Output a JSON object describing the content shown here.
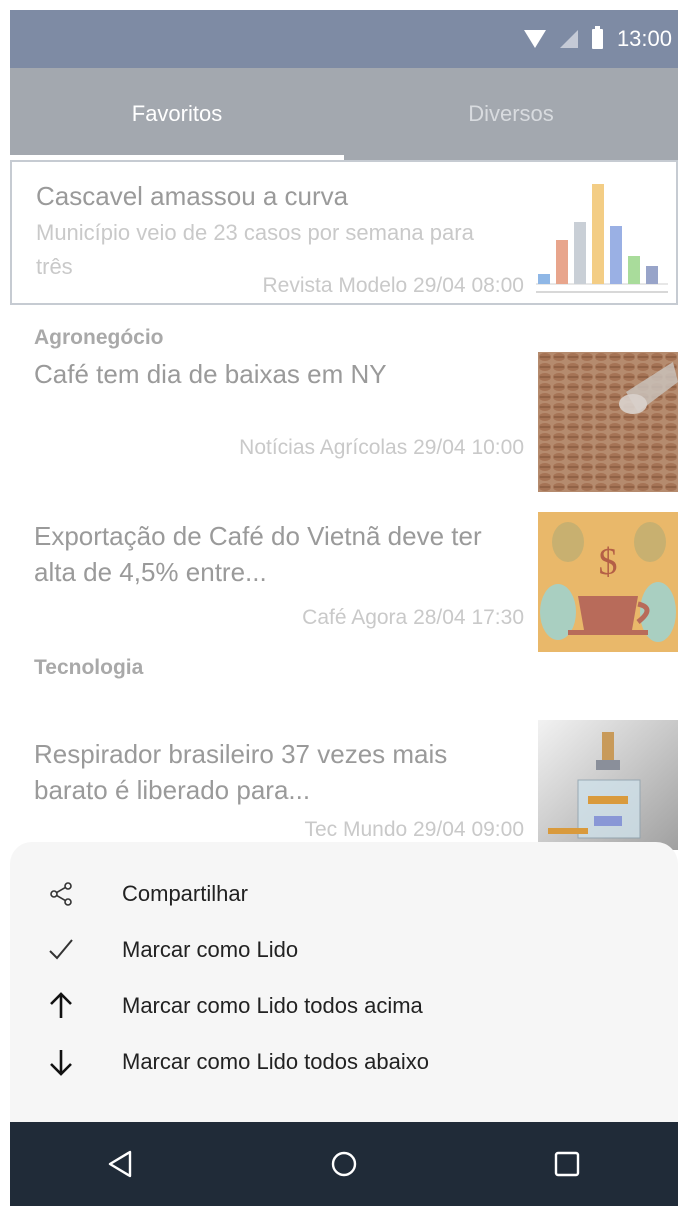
{
  "status_bar": {
    "time": "13:00",
    "icons": [
      "wifi-icon",
      "signal-icon",
      "battery-icon"
    ]
  },
  "tabs": [
    {
      "label": "Favoritos",
      "active": true
    },
    {
      "label": "Diversos",
      "active": false
    }
  ],
  "news": {
    "highlight": {
      "title": "Cascavel amassou a curva",
      "description": "Município veio de 23 casos por semana para três",
      "meta": "Revista Modelo 29/04 08:00"
    },
    "sections": [
      {
        "header": "Agronegócio",
        "items": [
          {
            "title": "Café tem dia de baixas em NY",
            "meta": "Notícias Agrícolas 29/04 10:00"
          },
          {
            "title": "Exportação de Café do Vietnã deve ter alta de 4,5% entre...",
            "meta": "Café Agora 28/04 17:30"
          }
        ]
      },
      {
        "header": "Tecnologia",
        "items": [
          {
            "title": "Respirador brasileiro 37 vezes mais barato é liberado para...",
            "meta": "Tec Mundo 29/04 09:00"
          }
        ]
      }
    ]
  },
  "bottom_sheet": {
    "items": [
      {
        "label": "Compartilhar",
        "icon": "share-icon"
      },
      {
        "label": "Marcar como Lido",
        "icon": "check-icon"
      },
      {
        "label": "Marcar como Lido todos acima",
        "icon": "arrow-up-icon"
      },
      {
        "label": "Marcar como Lido todos abaixo",
        "icon": "arrow-down-icon"
      }
    ]
  },
  "nav_bar": {
    "icons": [
      "back-icon",
      "home-icon",
      "recents-icon"
    ]
  },
  "colors": {
    "status_bar": "#7e8ba4",
    "tab_bar": "#a3a8af",
    "nav_bar": "#202b38",
    "sheet": "#f6f6f6"
  }
}
